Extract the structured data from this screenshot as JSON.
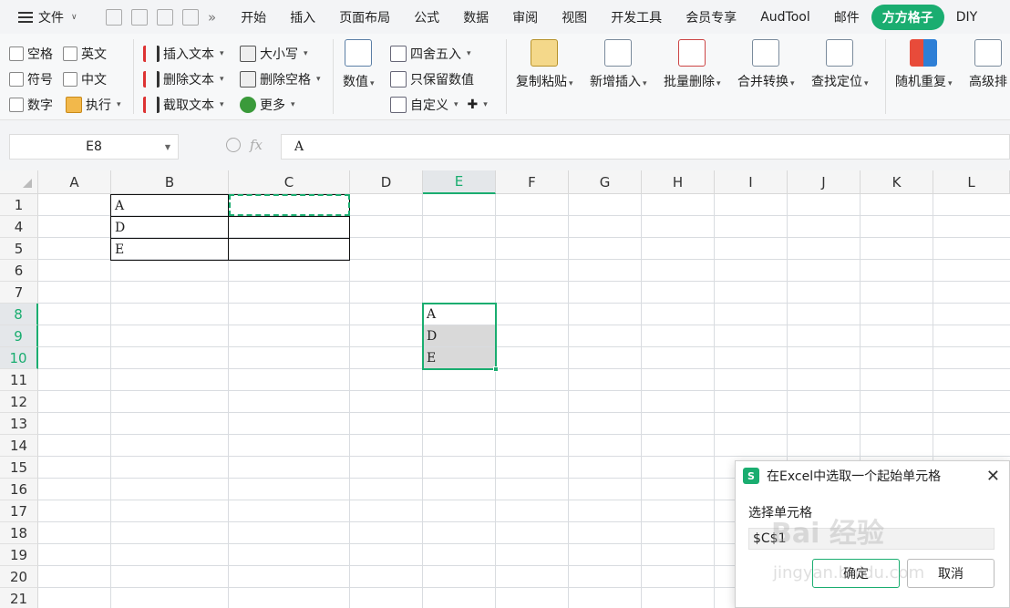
{
  "menubar": {
    "file_label": "文件",
    "tabs": [
      "开始",
      "插入",
      "页面布局",
      "公式",
      "数据",
      "审阅",
      "视图",
      "开发工具",
      "会员专享",
      "AudTool",
      "邮件",
      "方方格子",
      "DIY"
    ]
  },
  "ribbon": {
    "checkboxes": [
      "空格",
      "英文",
      "符号",
      "中文",
      "数字"
    ],
    "execute_label": "执行",
    "text_tools": [
      "插入文本",
      "删除文本",
      "截取文本"
    ],
    "case_tools": [
      "大小写",
      "删除空格",
      "更多"
    ],
    "value_label": "数值",
    "round_label": "四舍五入",
    "keep_values_label": "只保留数值",
    "custom_label": "自定义",
    "big_buttons": [
      "复制粘贴",
      "新增插入",
      "批量删除",
      "合并转换",
      "查找定位",
      "随机重复",
      "高级排"
    ]
  },
  "formula_bar": {
    "name_box": "E8",
    "fx_label": "fx",
    "content": "A"
  },
  "grid": {
    "columns": [
      "A",
      "B",
      "C",
      "D",
      "E",
      "F",
      "G",
      "H",
      "I",
      "J",
      "K",
      "L"
    ],
    "active_column": "E",
    "rows": [
      "1",
      "4",
      "5",
      "6",
      "7",
      "8",
      "9",
      "10",
      "11",
      "12",
      "13",
      "14",
      "15",
      "16",
      "17",
      "18",
      "19",
      "20",
      "21"
    ],
    "b_cells": [
      "A",
      "D",
      "E"
    ],
    "e_cells": [
      "A",
      "D",
      "E"
    ]
  },
  "dialog": {
    "title": "在Excel中选取一个起始单元格",
    "label": "选择单元格",
    "value": "$C$1",
    "ok": "确定",
    "cancel": "取消",
    "logo": "S"
  },
  "watermark": {
    "text": "Bai 经验",
    "url": "jingyan.baidu.com"
  },
  "colors": {
    "accent": "#1aad70",
    "selected_fill": "#d9d9d9"
  }
}
